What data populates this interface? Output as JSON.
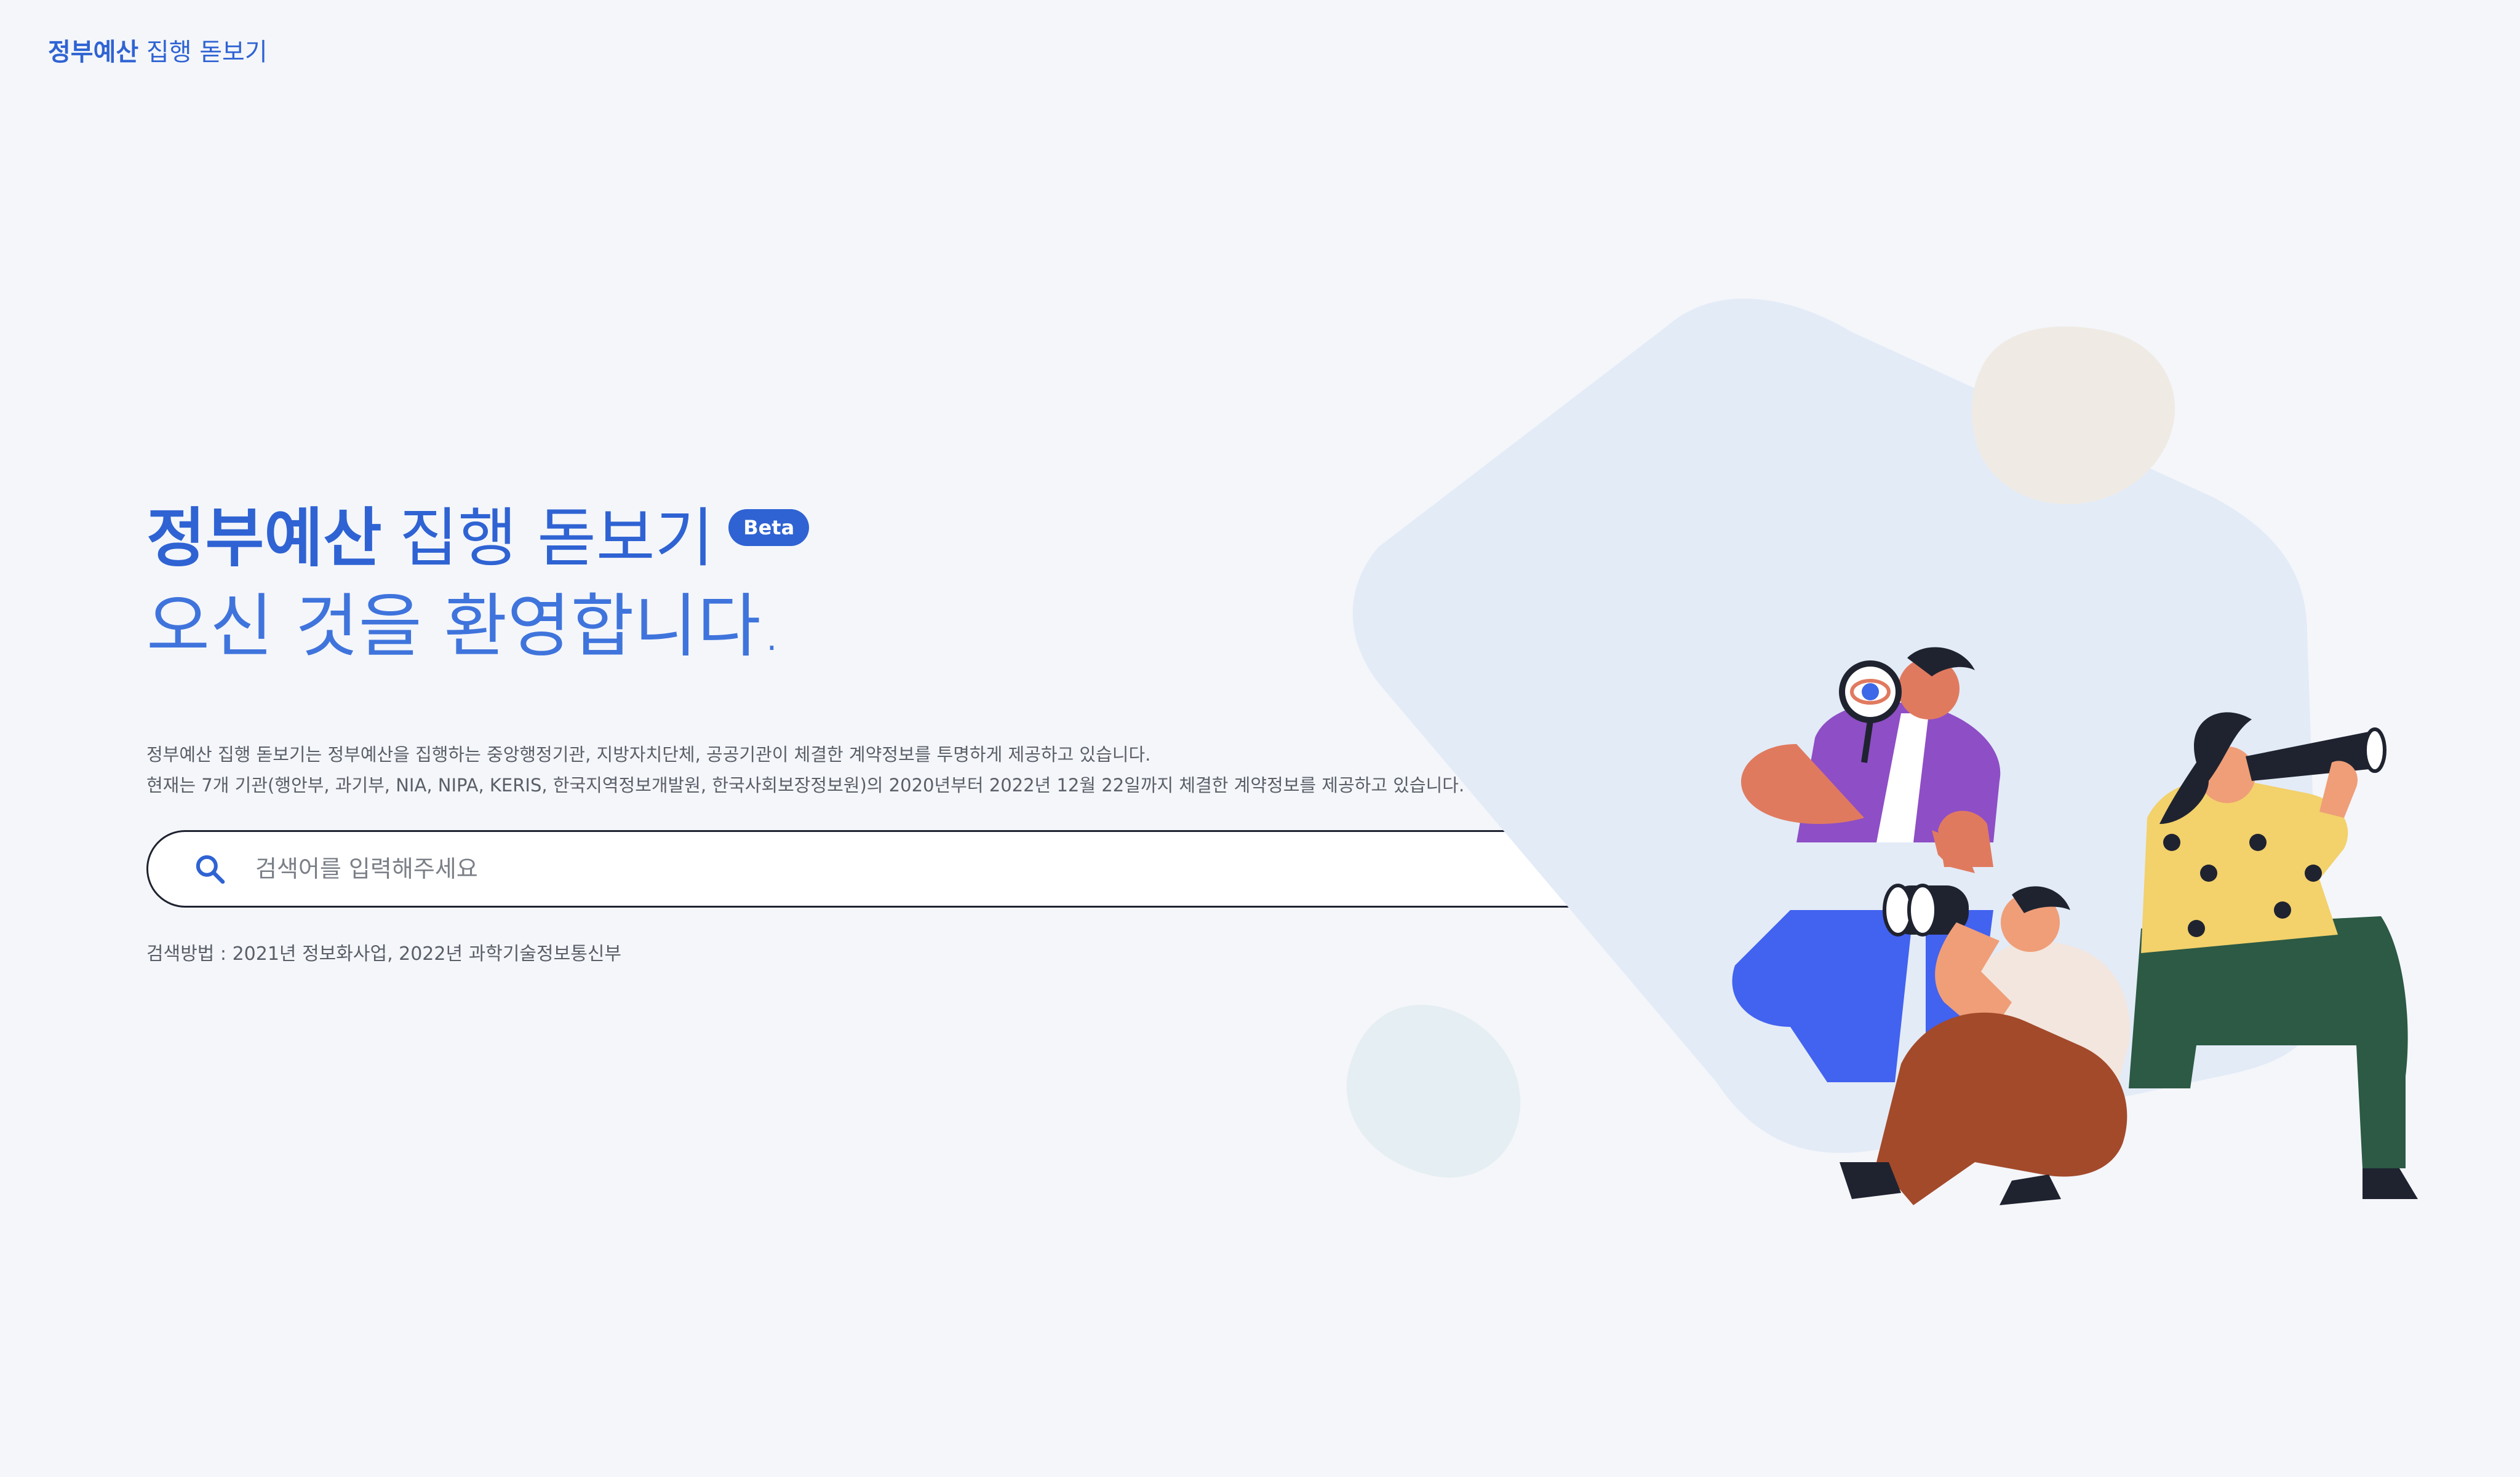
{
  "header": {
    "logo_bold": "정부예산",
    "logo_rest": " 집행 돋보기"
  },
  "hero": {
    "title_bold": "정부예산",
    "title_light": "집행 돋보기",
    "badge": "Beta",
    "welcome": "오신 것을 환영합니다."
  },
  "description": {
    "line1": "정부예산 집행 돋보기는 정부예산을 집행하는 중앙행정기관, 지방자치단체, 공공기관이 체결한 계약정보를 투명하게 제공하고 있습니다.",
    "line2": "현재는 7개 기관(행안부, 과기부, NIA, NIPA, KERIS, 한국지역정보개발원, 한국사회보장정보원)의 2020년부터 2022년 12월 22일까지 체결한 계약정보를 제공하고 있습니다."
  },
  "search": {
    "placeholder": "검색어를 입력해주세요",
    "value": "",
    "icon": "search-icon"
  },
  "footer_note": "검색방법 : 2021년 정보화사업, 2022년 과학기술정보통신부",
  "colors": {
    "brand": "#2f63d3",
    "background": "#f4f6fa"
  },
  "illustration": {
    "icons": [
      "magnifying-glass-icon",
      "binoculars-icon",
      "telescope-icon"
    ]
  }
}
